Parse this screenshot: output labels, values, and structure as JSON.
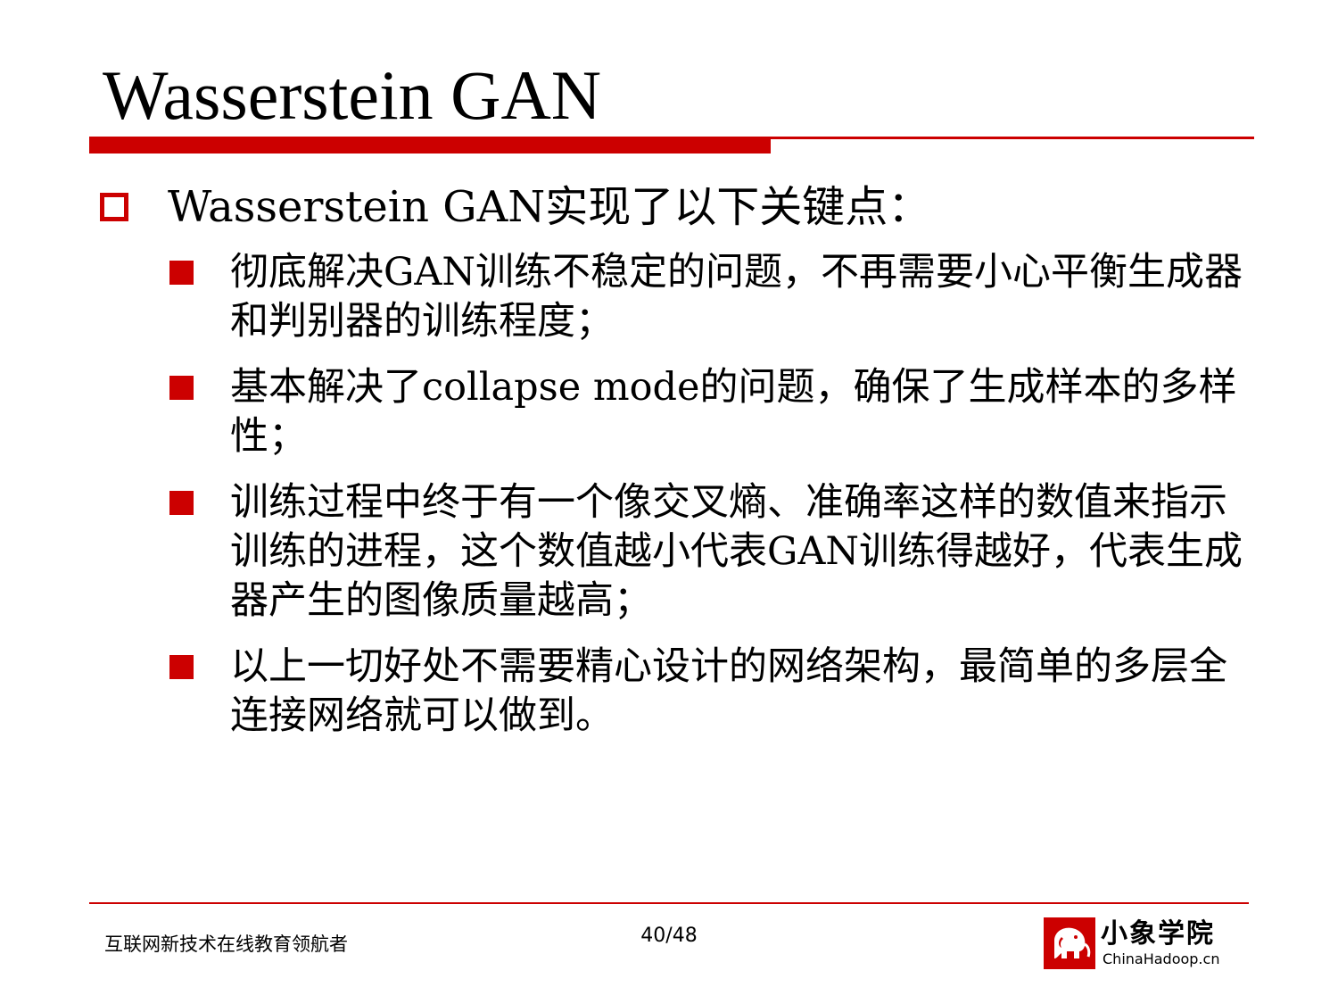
{
  "slide": {
    "title": "Wasserstein GAN"
  },
  "content": {
    "heading": "Wasserstein GAN实现了以下关键点：",
    "points": [
      "彻底解决GAN训练不稳定的问题，不再需要小心平衡生成器和判别器的训练程度；",
      "基本解决了collapse mode的问题，确保了生成样本的多样性；",
      "训练过程中终于有一个像交叉熵、准确率这样的数值来指示训练的进程，这个数值越小代表GAN训练得越好，代表生成器产生的图像质量越高；",
      "以上一切好处不需要精心设计的网络架构，最简单的多层全连接网络就可以做到。"
    ]
  },
  "footer": {
    "slogan": "互联网新技术在线教育领航者",
    "page": "40/48",
    "brand_name": "小象学院",
    "brand_url": "ChinaHadoop.cn"
  },
  "colors": {
    "accent": "#cc0000"
  },
  "icons": {
    "heading_bullet": "hollow-square-icon",
    "point_bullet": "filled-square-icon",
    "logo": "elephant-logo-icon"
  }
}
